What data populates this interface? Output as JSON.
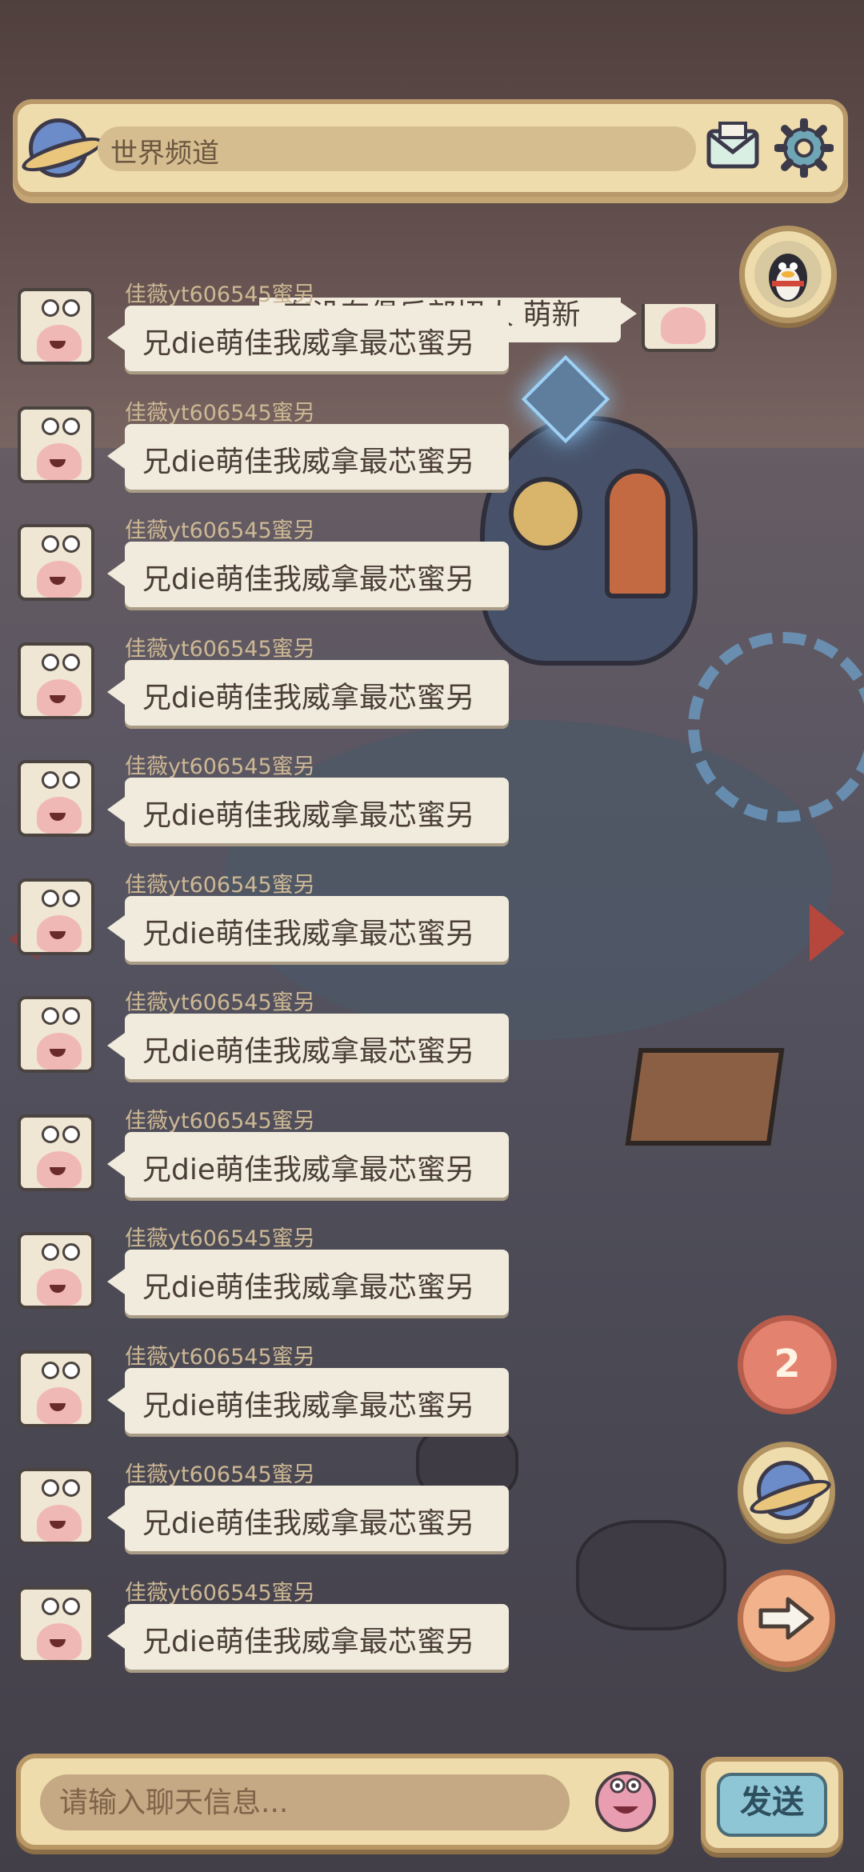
{
  "header": {
    "channel_title": "世界频道",
    "icons": [
      "planet-icon",
      "mail-icon",
      "gear-icon"
    ]
  },
  "top_message": {
    "text": "有没有俱乐部招人 萌新"
  },
  "messages": [
    {
      "username": "佳薇yt606545蜜另",
      "text": "兄die萌佳我威拿最芯蜜另"
    },
    {
      "username": "佳薇yt606545蜜另",
      "text": "兄die萌佳我威拿最芯蜜另"
    },
    {
      "username": "佳薇yt606545蜜另",
      "text": "兄die萌佳我威拿最芯蜜另"
    },
    {
      "username": "佳薇yt606545蜜另",
      "text": "兄die萌佳我威拿最芯蜜另"
    },
    {
      "username": "佳薇yt606545蜜另",
      "text": "兄die萌佳我威拿最芯蜜另"
    },
    {
      "username": "佳薇yt606545蜜另",
      "text": "兄die萌佳我威拿最芯蜜另"
    },
    {
      "username": "佳薇yt606545蜜另",
      "text": "兄die萌佳我威拿最芯蜜另"
    },
    {
      "username": "佳薇yt606545蜜另",
      "text": "兄die萌佳我威拿最芯蜜另"
    },
    {
      "username": "佳薇yt606545蜜另",
      "text": "兄die萌佳我威拿最芯蜜另"
    },
    {
      "username": "佳薇yt606545蜜另",
      "text": "兄die萌佳我威拿最芯蜜另"
    },
    {
      "username": "佳薇yt606545蜜另",
      "text": "兄die萌佳我威拿最芯蜜另"
    },
    {
      "username": "佳薇yt606545蜜另",
      "text": "兄die萌佳我威拿最芯蜜另"
    }
  ],
  "side_buttons": {
    "notification_count": "2",
    "icons": [
      "qq-penguin-icon",
      "planet-icon",
      "arrow-right-icon"
    ]
  },
  "composer": {
    "placeholder": "请输入聊天信息...",
    "value": "",
    "send_label": "发送"
  },
  "colors": {
    "panel": "#efdcac",
    "panel_border": "#b9986a",
    "bubble": "#f1ebdd",
    "badge": "#e3836f",
    "send_button": "#8fc6d6"
  }
}
